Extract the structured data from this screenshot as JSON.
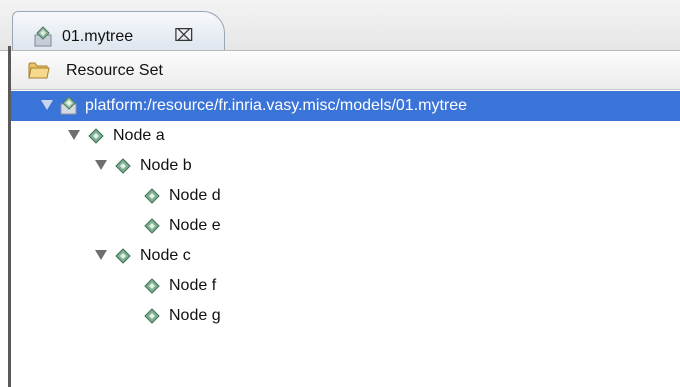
{
  "tab": {
    "title": "01.mytree",
    "close_symbol": "⌧",
    "icon": "mytree-file-icon"
  },
  "resource_set": {
    "label": "Resource Set",
    "icon": "folder-icon"
  },
  "tree": {
    "root": {
      "label": "platform:/resource/fr.inria.vasy.misc/models/01.mytree",
      "expanded": true,
      "selected": true,
      "icon": "model-file-icon"
    },
    "nodes": [
      {
        "label": "Node a",
        "depth": 1,
        "expanded": true
      },
      {
        "label": "Node b",
        "depth": 2,
        "expanded": true
      },
      {
        "label": "Node d",
        "depth": 3,
        "leaf": true
      },
      {
        "label": "Node e",
        "depth": 3,
        "leaf": true
      },
      {
        "label": "Node c",
        "depth": 2,
        "expanded": true
      },
      {
        "label": "Node f",
        "depth": 3,
        "leaf": true
      },
      {
        "label": "Node g",
        "depth": 3,
        "leaf": true
      }
    ]
  },
  "colors": {
    "selection": "#3b74d8",
    "node_icon": "#6fa08a"
  }
}
